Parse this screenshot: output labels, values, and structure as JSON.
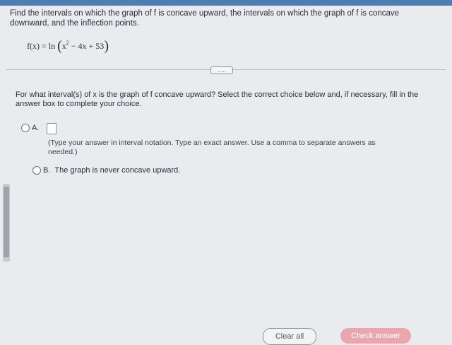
{
  "question": {
    "text": "Find the intervals on which the graph of f is concave upward, the intervals on which the graph of f is concave downward, and the inflection points."
  },
  "function": {
    "lhs": "f(x) = ln",
    "x_term": "x",
    "exponent": "2",
    "rest": " − 4x + 53"
  },
  "more_button": {
    "label": "....."
  },
  "prompt": {
    "text": "For what interval(s) of x is the graph of f concave upward? Select the correct choice below and, if necessary, fill in the answer box to complete your choice."
  },
  "choice_a": {
    "label": "A.",
    "hint": "(Type your answer in interval notation. Type an exact answer. Use a comma to separate answers as needed.)"
  },
  "choice_b": {
    "label": "B.",
    "text": "The graph is never concave upward."
  },
  "footer": {
    "clear_label": "Clear all",
    "check_label": "Check answer"
  },
  "colors": {
    "accent": "#4f7fb0",
    "check_button": "#e9a7ad"
  }
}
